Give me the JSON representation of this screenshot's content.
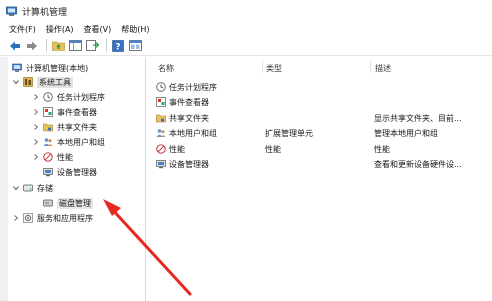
{
  "window": {
    "title": "计算机管理"
  },
  "menu": {
    "items": [
      "文件(F)",
      "操作(A)",
      "查看(V)",
      "帮助(H)"
    ]
  },
  "tree": {
    "root": "计算机管理(本地)",
    "system_tools": "系统工具",
    "task_scheduler": "任务计划程序",
    "event_viewer": "事件查看器",
    "shared_folders": "共享文件夹",
    "local_users": "本地用户和组",
    "performance": "性能",
    "device_manager": "设备管理器",
    "storage": "存储",
    "disk_management": "磁盘管理",
    "services_apps": "服务和应用程序"
  },
  "list": {
    "headers": {
      "name": "名称",
      "type": "类型",
      "desc": "描述"
    },
    "rows": [
      {
        "name": "任务计划程序",
        "type": "",
        "desc": "",
        "icon": "clock-icon"
      },
      {
        "name": "事件查看器",
        "type": "",
        "desc": "",
        "icon": "event-viewer-icon"
      },
      {
        "name": "共享文件夹",
        "type": "",
        "desc": "显示共享文件夹、目前...",
        "icon": "shared-folder-icon"
      },
      {
        "name": "本地用户和组",
        "type": "扩展管理单元",
        "desc": "管理本地用户和组",
        "icon": "users-icon"
      },
      {
        "name": "性能",
        "type": "性能",
        "desc": "性能",
        "icon": "performance-icon"
      },
      {
        "name": "设备管理器",
        "type": "",
        "desc": "查看和更新设备硬件设...",
        "icon": "device-manager-icon"
      }
    ]
  },
  "colors": {
    "arrow": "#e8281e",
    "selection": "#cfe5f7",
    "nav_arrow": "#2c6fbf"
  }
}
